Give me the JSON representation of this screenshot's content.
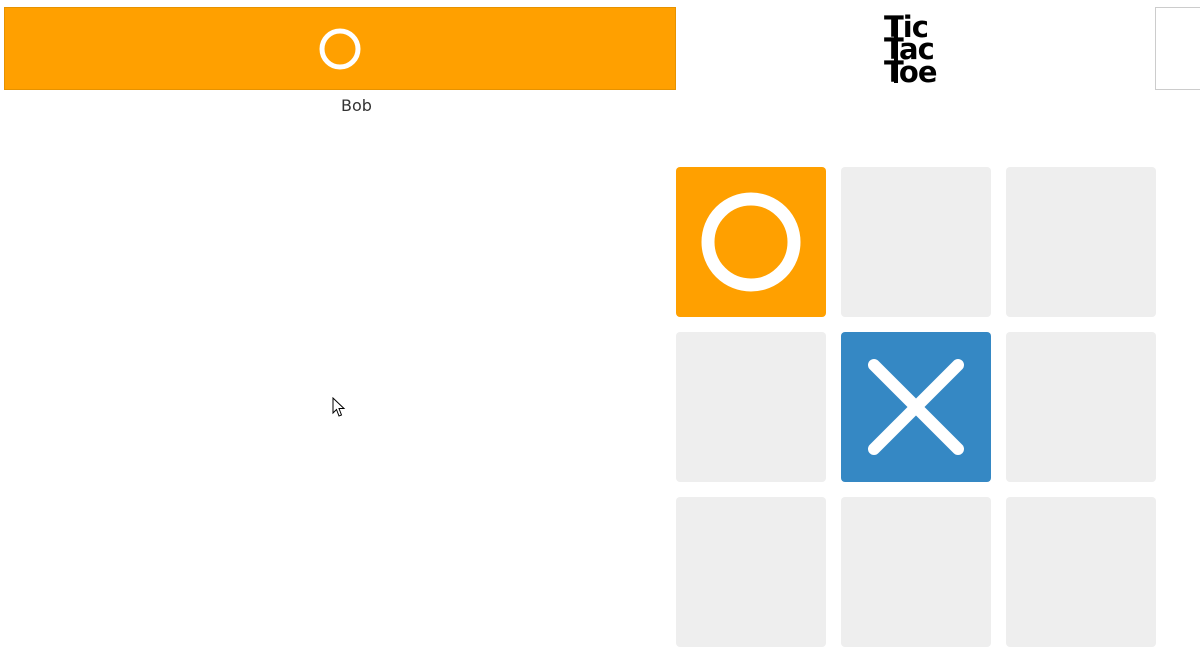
{
  "player": {
    "name": "Bob",
    "mark": "O",
    "mark_icon": "o-mark-icon",
    "color": "#ffa000"
  },
  "title": {
    "line1": "Tic",
    "line2": "Tac",
    "line3": "Toe"
  },
  "colors": {
    "o": "#ffa000",
    "x": "#3588c4",
    "empty": "#eeeeee"
  },
  "board": {
    "cells": [
      "O",
      "",
      "",
      "",
      "X",
      "",
      "",
      "",
      ""
    ]
  }
}
